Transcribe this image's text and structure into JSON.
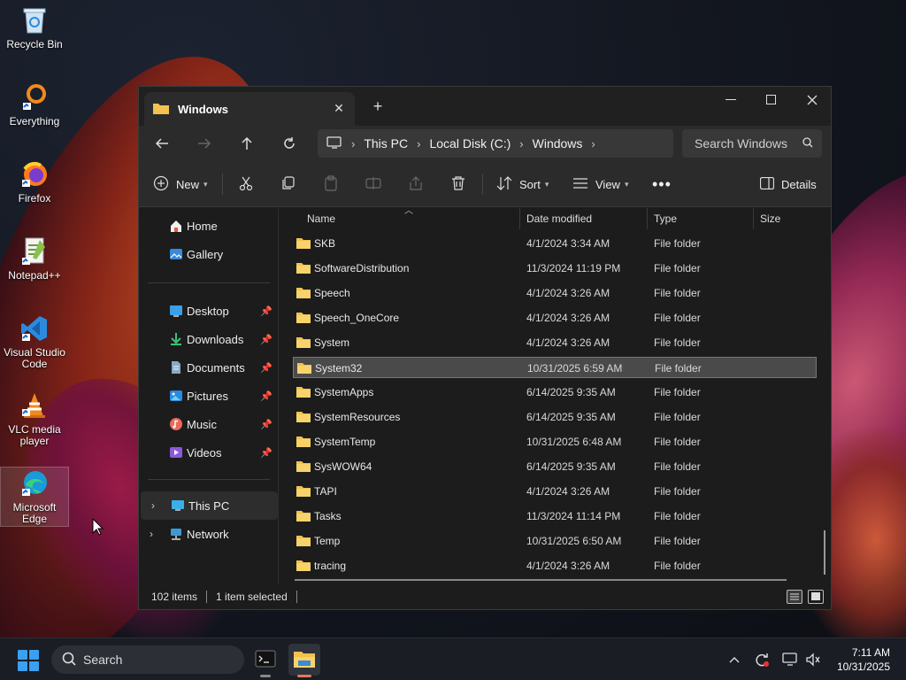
{
  "desktop": {
    "icons": [
      {
        "label": "Recycle Bin"
      },
      {
        "label": "Everything"
      },
      {
        "label": "Firefox"
      },
      {
        "label": "Notepad++"
      },
      {
        "label": "Visual Studio Code"
      },
      {
        "label": "VLC media player"
      },
      {
        "label": "Microsoft Edge"
      }
    ]
  },
  "window": {
    "tab_title": "Windows",
    "breadcrumb": [
      "This PC",
      "Local Disk (C:)",
      "Windows"
    ],
    "search_placeholder": "Search Windows",
    "toolbar": {
      "new_label": "New",
      "sort_label": "Sort",
      "view_label": "View",
      "details_label": "Details"
    },
    "sidebar": {
      "top": [
        {
          "label": "Home"
        },
        {
          "label": "Gallery"
        }
      ],
      "quick": [
        {
          "label": "Desktop"
        },
        {
          "label": "Downloads"
        },
        {
          "label": "Documents"
        },
        {
          "label": "Pictures"
        },
        {
          "label": "Music"
        },
        {
          "label": "Videos"
        }
      ],
      "bottom": [
        {
          "label": "This PC"
        },
        {
          "label": "Network"
        }
      ]
    },
    "columns": {
      "name": "Name",
      "date": "Date modified",
      "type": "Type",
      "size": "Size"
    },
    "files": [
      {
        "name": "SKB",
        "date": "4/1/2024 3:34 AM",
        "type": "File folder"
      },
      {
        "name": "SoftwareDistribution",
        "date": "11/3/2024 11:19 PM",
        "type": "File folder"
      },
      {
        "name": "Speech",
        "date": "4/1/2024 3:26 AM",
        "type": "File folder"
      },
      {
        "name": "Speech_OneCore",
        "date": "4/1/2024 3:26 AM",
        "type": "File folder"
      },
      {
        "name": "System",
        "date": "4/1/2024 3:26 AM",
        "type": "File folder"
      },
      {
        "name": "System32",
        "date": "10/31/2025 6:59 AM",
        "type": "File folder"
      },
      {
        "name": "SystemApps",
        "date": "6/14/2025 9:35 AM",
        "type": "File folder"
      },
      {
        "name": "SystemResources",
        "date": "6/14/2025 9:35 AM",
        "type": "File folder"
      },
      {
        "name": "SystemTemp",
        "date": "10/31/2025 6:48 AM",
        "type": "File folder"
      },
      {
        "name": "SysWOW64",
        "date": "6/14/2025 9:35 AM",
        "type": "File folder"
      },
      {
        "name": "TAPI",
        "date": "4/1/2024 3:26 AM",
        "type": "File folder"
      },
      {
        "name": "Tasks",
        "date": "11/3/2024 11:14 PM",
        "type": "File folder"
      },
      {
        "name": "Temp",
        "date": "10/31/2025 6:50 AM",
        "type": "File folder"
      },
      {
        "name": "tracing",
        "date": "4/1/2024 3:26 AM",
        "type": "File folder"
      }
    ],
    "status": {
      "item_count": "102 items",
      "selection": "1 item selected"
    }
  },
  "taskbar": {
    "search_label": "Search",
    "time": "7:11 AM",
    "date": "10/31/2025"
  }
}
